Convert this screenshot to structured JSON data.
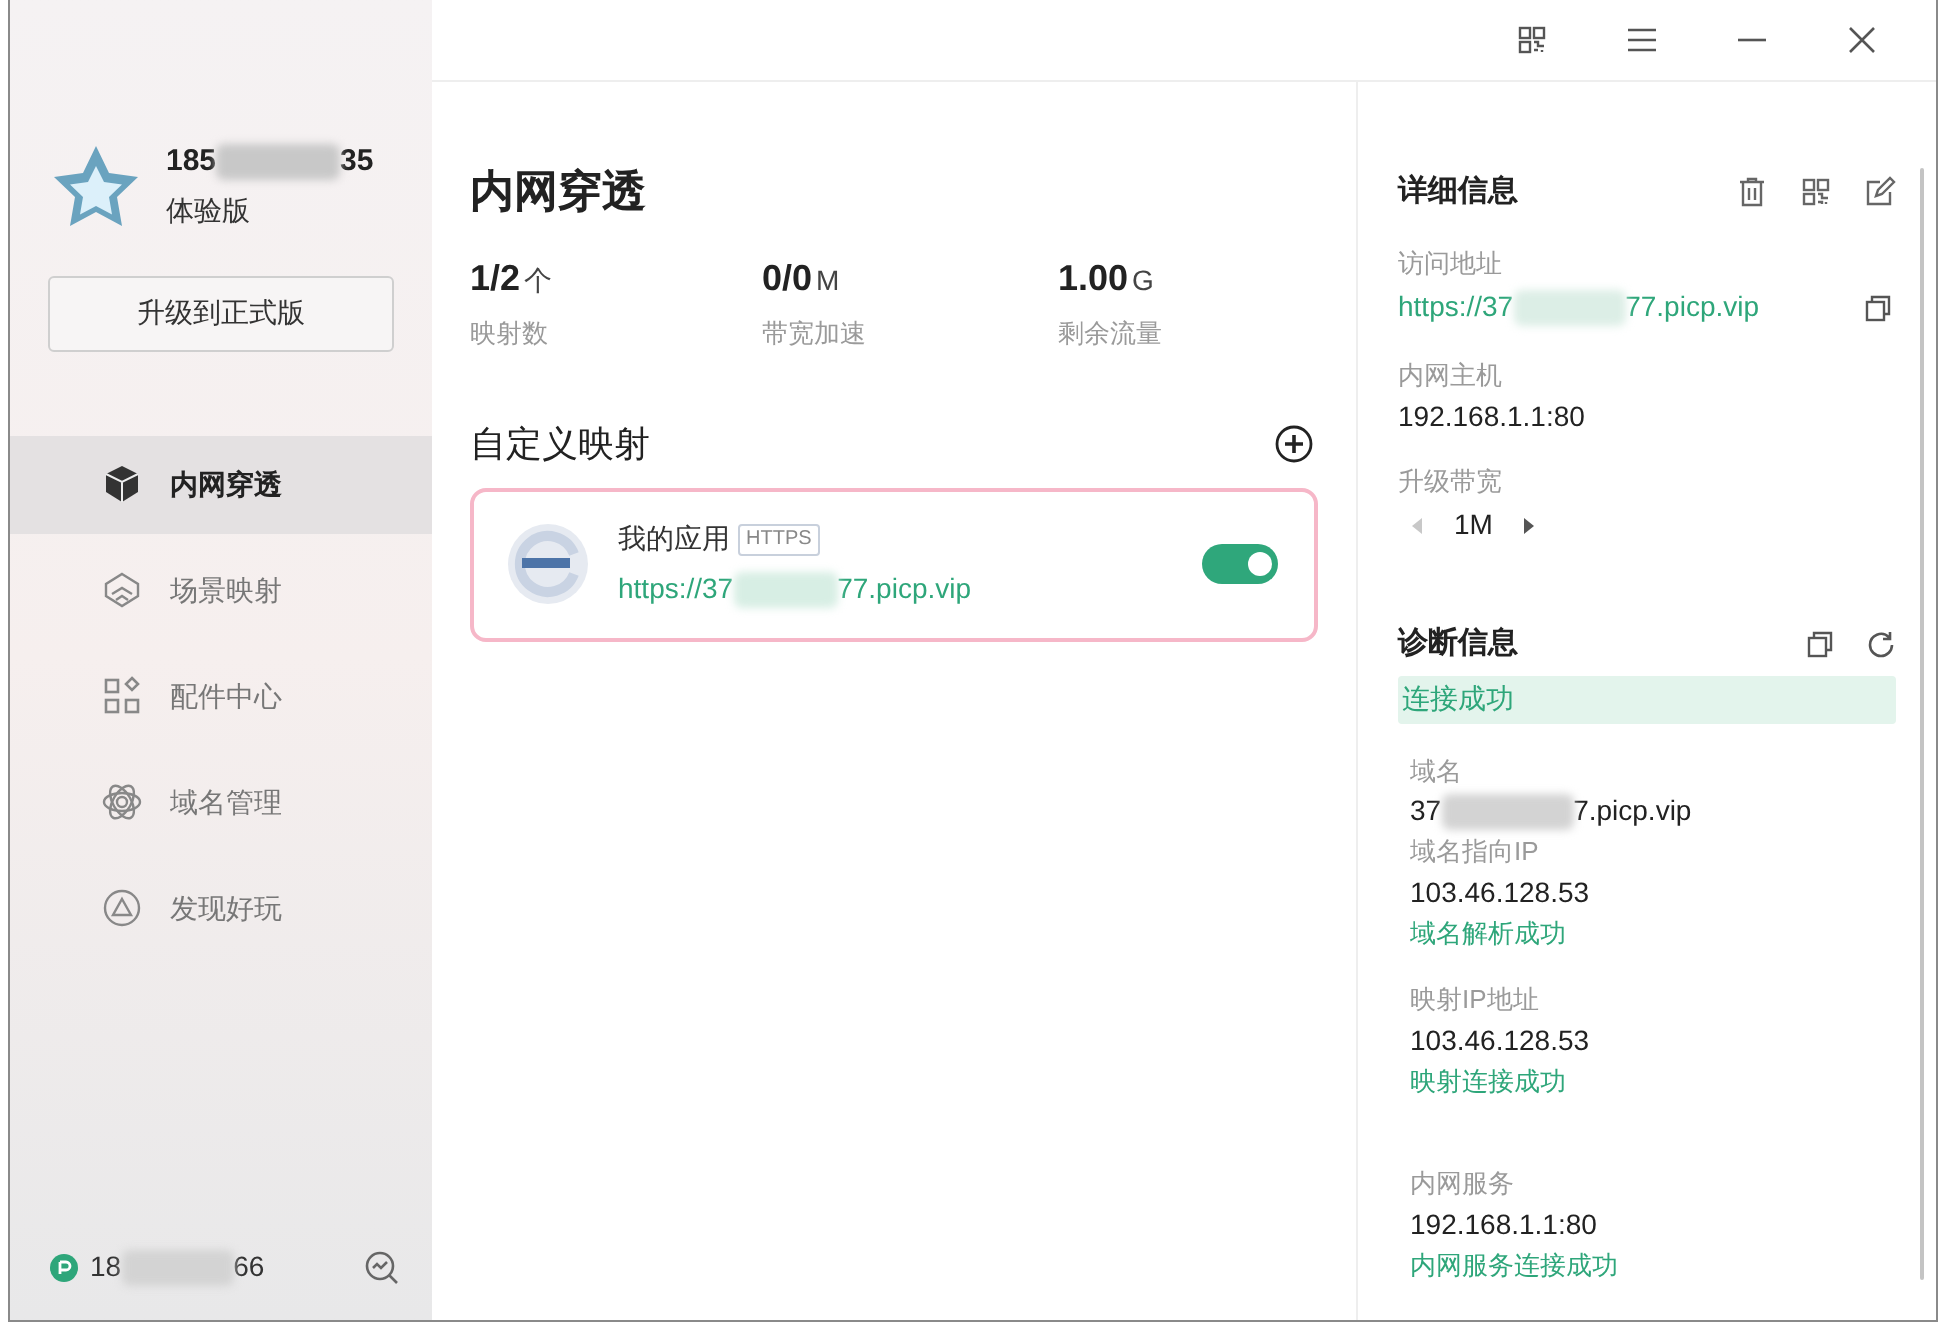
{
  "window_controls": [
    {
      "kind": "qr"
    },
    {
      "kind": "menu"
    },
    {
      "kind": "minimize"
    },
    {
      "kind": "close"
    }
  ],
  "account": {
    "phone_start": "185",
    "phone_end": "35",
    "plan": "体验版",
    "upgrade_button": "升级到正式版"
  },
  "nav": [
    {
      "label": "内网穿透",
      "kind": "cube",
      "selected": true
    },
    {
      "label": "场景映射",
      "kind": "scene",
      "selected": false
    },
    {
      "label": "配件中心",
      "kind": "grid",
      "selected": false
    },
    {
      "label": "域名管理",
      "kind": "atom",
      "selected": false
    },
    {
      "label": "发现好玩",
      "kind": "discover",
      "selected": false
    }
  ],
  "footer": {
    "phone_start": "18",
    "phone_end": "66"
  },
  "page_title": "内网穿透",
  "stats": [
    {
      "value": "1/2",
      "unit": "个",
      "label": "映射数"
    },
    {
      "value": "0/0",
      "unit": "M",
      "label": "带宽加速"
    },
    {
      "value": "1.00",
      "unit": "G",
      "label": "剩余流量"
    }
  ],
  "mappings_title": "自定义映射",
  "mappings": [
    {
      "name": "我的应用",
      "protocol": "HTTPS",
      "url_start": "https://37",
      "url_end": "77.picp.vip",
      "on": true
    }
  ],
  "details": {
    "title": "详细信息",
    "address_label": "访问地址",
    "address_start": "https://37",
    "address_end": "77.picp.vip",
    "host_label": "内网主机",
    "host": "192.168.1.1:80",
    "bandwidth_label": "升级带宽",
    "bandwidth": "1M"
  },
  "diagnostics": {
    "title": "诊断信息",
    "status": "连接成功",
    "groups": [
      {
        "items": [
          {
            "label": "域名",
            "value_start": "37",
            "value_end": "7.picp.vip"
          },
          {
            "label": "域名指向IP",
            "value": "103.46.128.53",
            "result": "域名解析成功"
          }
        ]
      },
      {
        "items": [
          {
            "label": "映射IP地址",
            "value": "103.46.128.53",
            "result": "映射连接成功"
          }
        ]
      },
      {
        "items": [
          {
            "label": "内网服务",
            "value": "192.168.1.1:80",
            "result": "内网服务连接成功"
          }
        ]
      }
    ]
  }
}
